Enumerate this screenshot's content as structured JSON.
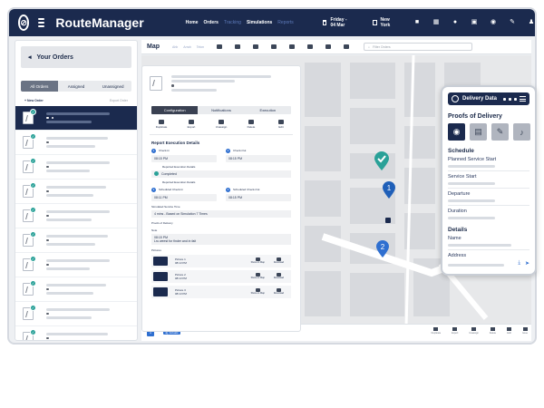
{
  "app": {
    "name": "RouteManager"
  },
  "nav": {
    "items": [
      "Home",
      "Orders",
      "Tracking",
      "Simulations",
      "Reports"
    ]
  },
  "topbar": {
    "date": "Friday - 04 Mar",
    "city": "New York"
  },
  "orders_panel": {
    "title": "Your Orders",
    "tabs": [
      "All Orders",
      "Assigned",
      "Unassigned"
    ],
    "new_order": "+ New Order",
    "export": "Export Order"
  },
  "map_panel": {
    "title": "Map",
    "options": [
      "Ahb",
      "Arrah",
      "Tekm"
    ],
    "search_placeholder": "Filter Orders"
  },
  "detail": {
    "tabs": [
      "Configuration",
      "Notifications",
      "Execution"
    ],
    "actions": [
      "Duplicate",
      "Export",
      "Unassign",
      "Delete",
      "Edit"
    ],
    "section_title": "Report Execution Details",
    "check_in_label": "Check-In",
    "check_in_value": "08:15 PM",
    "check_out_label": "Check-Out",
    "check_out_value": "08:15 PM",
    "reported_label": "Reported Execution Details",
    "completed": "Completed",
    "reported_label2": "Reported Execution Details",
    "sched_in_label": "Scheduled Check-In",
    "sched_in_value": "08:11 PM",
    "sched_out_label": "Scheduled Check-Out",
    "sched_out_value": "08:15 PM",
    "sim_time_label": "Simulated Service Time",
    "sim_time_value": "4 mins - Based on Simulation 7 Times",
    "pod_label": "Proofs of Delivery",
    "note_label": "Note",
    "note_time": "08:15 PM",
    "note_text": "Lru weest for finder and in fait",
    "pictures_label": "Pictures",
    "pictures": [
      {
        "name": "Picture 1",
        "time": "08:13 PM",
        "a1": "Show on Map",
        "a2": "Download"
      },
      {
        "name": "Picture 2",
        "time": "08:13 PM",
        "a1": "Show on Map",
        "a2": "Download"
      },
      {
        "name": "Picture 3",
        "time": "08:13 PM",
        "a1": "Show on Map",
        "a2": "Download"
      }
    ]
  },
  "map_bottom": {
    "count": "1",
    "tag": "Jg. Actuals",
    "actions": [
      "Duplicate",
      "Export",
      "Unassign",
      "Delete",
      "Edit",
      "Issue"
    ]
  },
  "phone": {
    "title": "Delivery Data",
    "pod_title": "Proofs of Delivery",
    "schedule_title": "Schedule",
    "fields": [
      "Planned Service Start",
      "Service Start",
      "Departure",
      "Duration"
    ],
    "details_title": "Details",
    "name_label": "Name",
    "address_label": "Address"
  },
  "colors": {
    "navy": "#1b2a4e",
    "teal": "#2aa198",
    "blue": "#2f6fd0"
  }
}
